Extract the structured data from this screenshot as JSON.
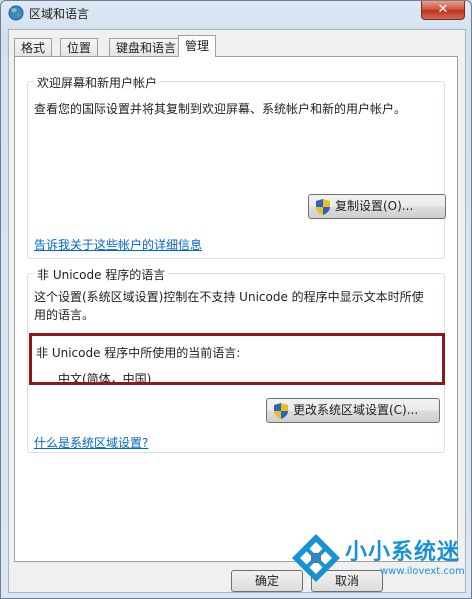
{
  "window": {
    "title": "区域和语言",
    "close_glyph": "✕"
  },
  "tabs": [
    {
      "label": "格式",
      "active": false
    },
    {
      "label": "位置",
      "active": false
    },
    {
      "label": "键盘和语言",
      "active": false
    },
    {
      "label": "管理",
      "active": true
    }
  ],
  "welcome_group": {
    "title": "欢迎屏幕和新用户帐户",
    "description": "查看您的国际设置并将其复制到欢迎屏幕、系统帐户和新的用户帐户。",
    "copy_button": "复制设置(O)...",
    "details_link": "告诉我关于这些帐户的详细信息"
  },
  "unicode_group": {
    "title": "非 Unicode 程序的语言",
    "description_line1": "这个设置(系统区域设置)控制在不支持 Unicode 的程序中显示文本时所使",
    "description_line2": "用的语言。",
    "current_label": "非 Unicode 程序中所使用的当前语言:",
    "current_value": "中文(简体，中国)",
    "change_button": "更改系统区域设置(C)...",
    "help_link": "什么是系统区域设置?"
  },
  "footer": {
    "ok_button": "确定",
    "cancel_button": "取消"
  },
  "watermark": {
    "text": "小小系统迷",
    "url": "www.ilovext.com"
  },
  "colors": {
    "highlight_border": "#8b1a1a",
    "link": "#0066cc",
    "watermark": "#1792d6"
  },
  "icons": {
    "title": "globe-icon",
    "uac": "uac-shield-icon"
  }
}
